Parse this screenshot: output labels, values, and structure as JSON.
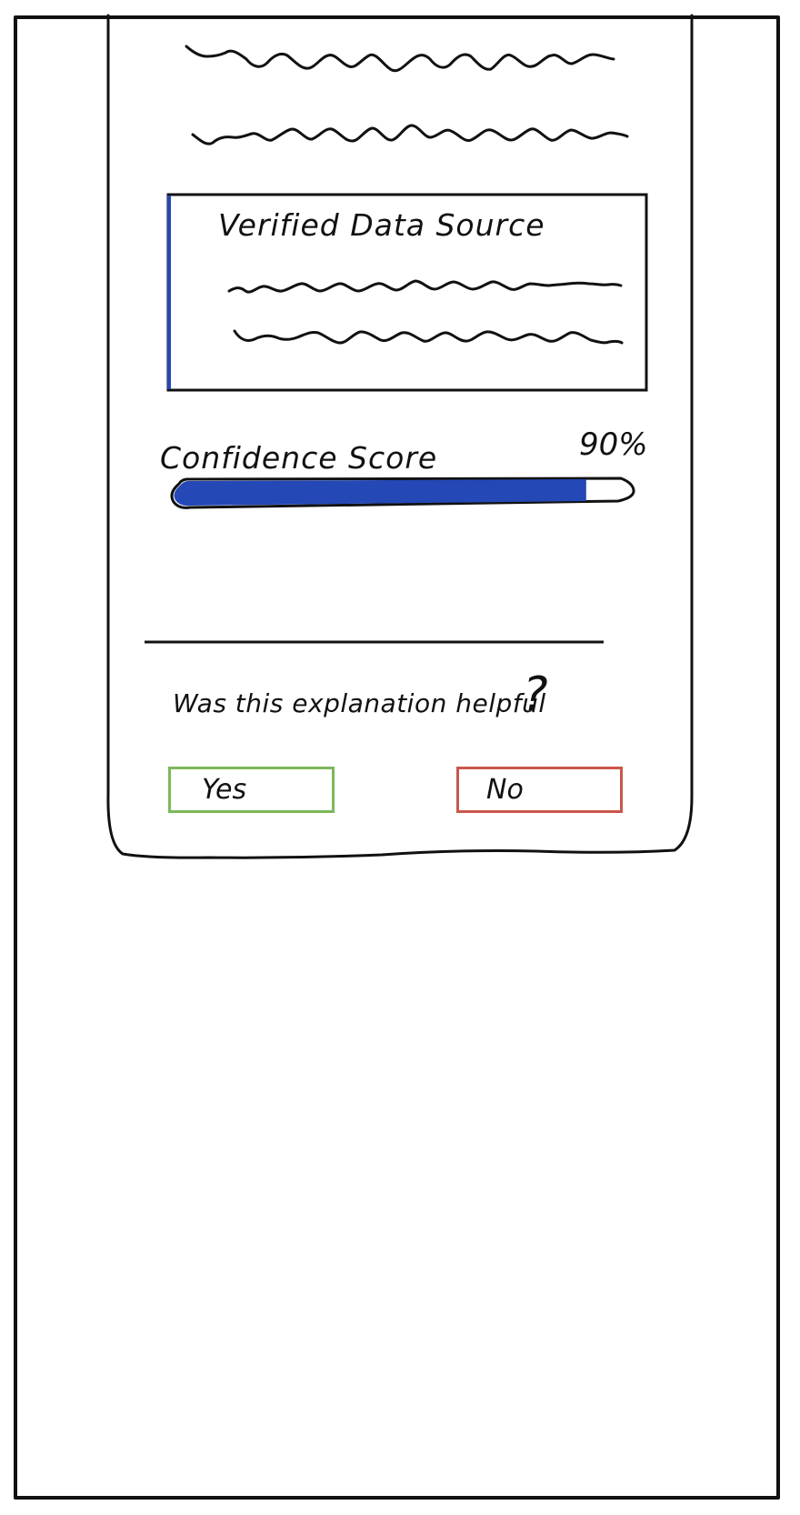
{
  "sheet": {
    "source_card": {
      "title": "Verified Data Source"
    },
    "confidence": {
      "label": "Confidence Score",
      "value_text": "90%",
      "progress": 0.9,
      "fill_color": "#2448b5"
    },
    "feedback": {
      "question": "Was this explanation helpful",
      "question_mark": "?",
      "yes_label": "Yes",
      "no_label": "No",
      "yes_color": "#7db85a",
      "no_color": "#c9574a"
    }
  }
}
